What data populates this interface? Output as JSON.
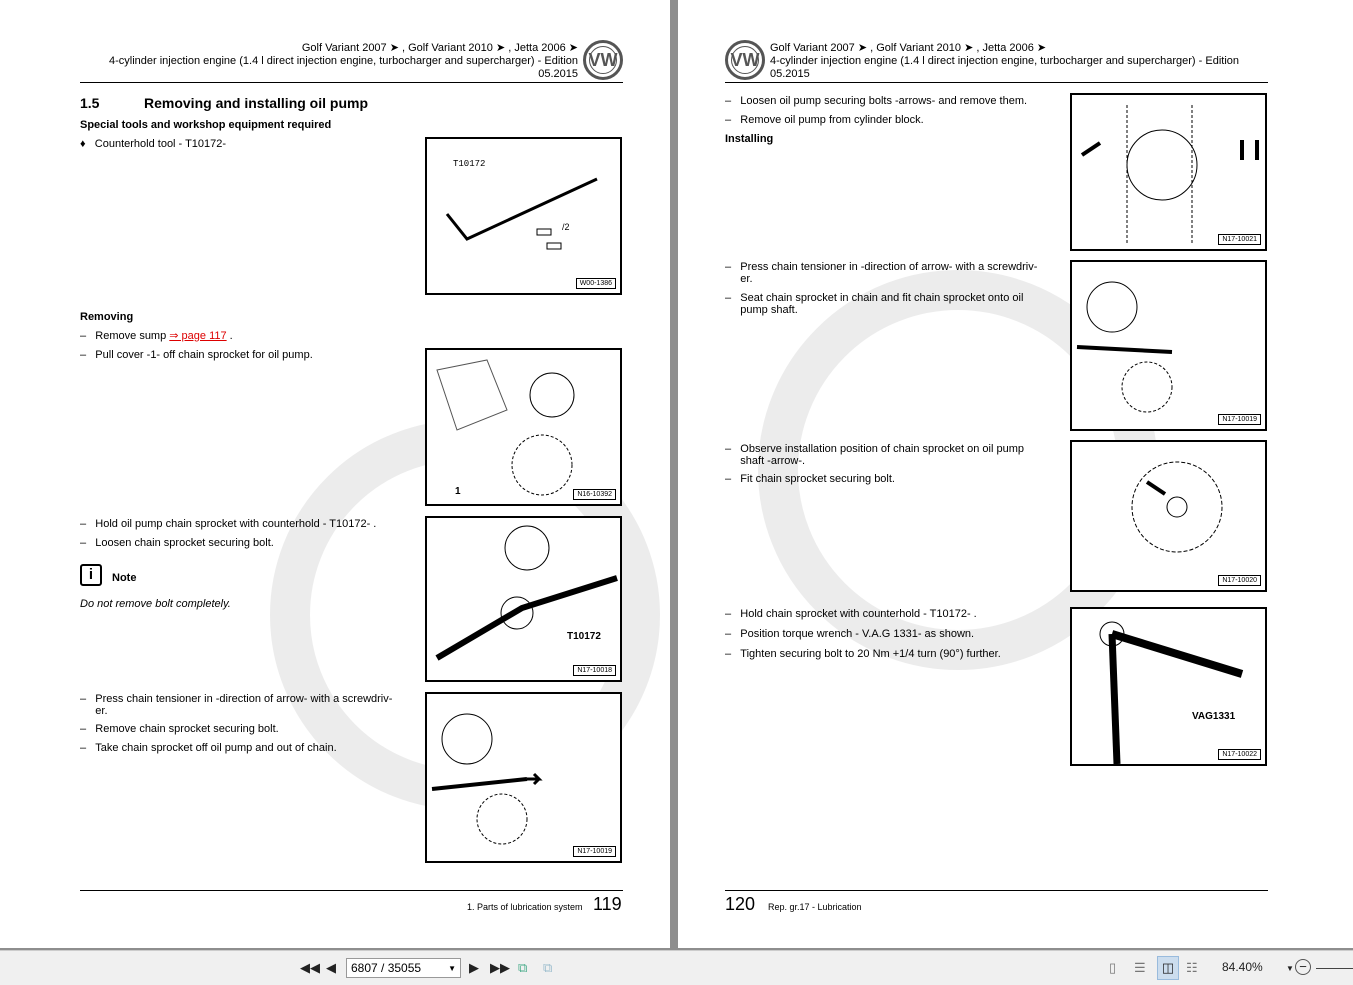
{
  "header": {
    "models": "Golf Variant 2007 ➤ , Golf Variant 2010 ➤ , Jetta 2006 ➤",
    "engine": "4-cylinder injection engine (1.4 l direct injection engine, turbocharger and supercharger) -",
    "edition": "Edition",
    "edition_date": "05.2015"
  },
  "left": {
    "section_num": "1.5",
    "section_title": "Removing and installing oil pump",
    "tools_heading": "Special tools and workshop equipment required",
    "tool_item": "Counterhold tool - T10172-",
    "removing": "Removing",
    "step1_pre": "Remove sump ",
    "step1_link": "⇒ page 117",
    " step1_post": " .",
    "step2": "Pull cover -1- off chain sprocket for oil pump.",
    "step3": "Hold oil pump chain sprocket with counterhold - T10172- .",
    "step4": "Loosen chain sprocket securing bolt.",
    "note_label": "Note",
    "note_text": "Do not remove bolt completely.",
    "step5": "Press chain tensioner in -direction of arrow- with a screwdriv-",
    "step5b": "er.",
    "step6": "Remove chain sprocket securing bolt.",
    "step7": "Take chain sprocket off oil pump and out of chain.",
    "figs": [
      {
        "code": "W00-1386",
        "label": "T10172",
        "label2": "/2"
      },
      {
        "code": "N16-10392",
        "label": "1"
      },
      {
        "code": "N17-10018",
        "label": "T10172"
      },
      {
        "code": "N17-10019"
      }
    ],
    "footer_text": "1. Parts of lubrication system",
    "page_num": "119"
  },
  "right": {
    "step1": "Loosen oil pump securing bolts -arrows- and remove them.",
    "step2": "Remove oil pump from cylinder block.",
    "installing": "Installing",
    "step3": "Press chain tensioner in -direction of arrow- with a screwdriv-",
    "step3b": "er.",
    "step4": "Seat chain sprocket in chain and fit chain sprocket onto oil",
    "step4b": "pump shaft.",
    "step5": "Observe installation position of chain sprocket on oil pump",
    "step5b": "shaft -arrow-.",
    "step6": "Fit chain sprocket securing bolt.",
    "step7": "Hold chain sprocket with counterhold - T10172- .",
    "step8": "Position torque wrench - V.A.G 1331- as shown.",
    "step9": "Tighten securing bolt to 20 Nm +1/4 turn (90°) further.",
    "figs": [
      {
        "code": "N17-10021"
      },
      {
        "code": "N17-10019"
      },
      {
        "code": "N17-10020"
      },
      {
        "code": "N17-10022",
        "label": "VAG1331"
      }
    ],
    "page_num": "120",
    "footer_text": "Rep. gr.17 - Lubrication"
  },
  "toolbar": {
    "page": "6807 / 35055",
    "zoom": "84.40%"
  }
}
